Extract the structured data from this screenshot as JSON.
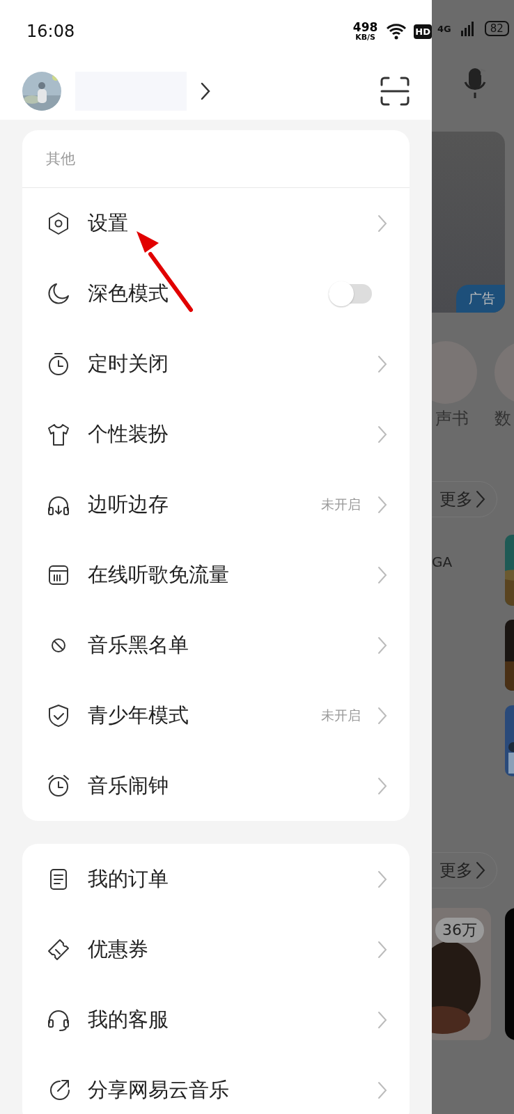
{
  "status_bar": {
    "time": "16:08",
    "net_speed": "498",
    "net_unit": "KB/S",
    "hd_badge": "HD",
    "network": "4G",
    "battery": "82"
  },
  "menu_sections": [
    {
      "header": "其他",
      "items": [
        {
          "label": "设置",
          "kind": "link"
        },
        {
          "label": "深色模式",
          "kind": "toggle",
          "on": false
        },
        {
          "label": "定时关闭",
          "kind": "link"
        },
        {
          "label": "个性装扮",
          "kind": "link"
        },
        {
          "label": "边听边存",
          "kind": "link",
          "status": "未开启"
        },
        {
          "label": "在线听歌免流量",
          "kind": "link"
        },
        {
          "label": "音乐黑名单",
          "kind": "link"
        },
        {
          "label": "青少年模式",
          "kind": "link",
          "status": "未开启"
        },
        {
          "label": "音乐闹钟",
          "kind": "link"
        }
      ]
    },
    {
      "items": [
        {
          "label": "我的订单",
          "kind": "link"
        },
        {
          "label": "优惠券",
          "kind": "link"
        },
        {
          "label": "我的客服",
          "kind": "link"
        },
        {
          "label": "分享网易云音乐",
          "kind": "link"
        }
      ]
    }
  ],
  "background": {
    "ad_label": "广告",
    "shortcut_labels": [
      "声书",
      "数"
    ],
    "more_links": [
      "更多",
      "更多"
    ],
    "song_fragment": "GA",
    "play_count": "36万"
  }
}
